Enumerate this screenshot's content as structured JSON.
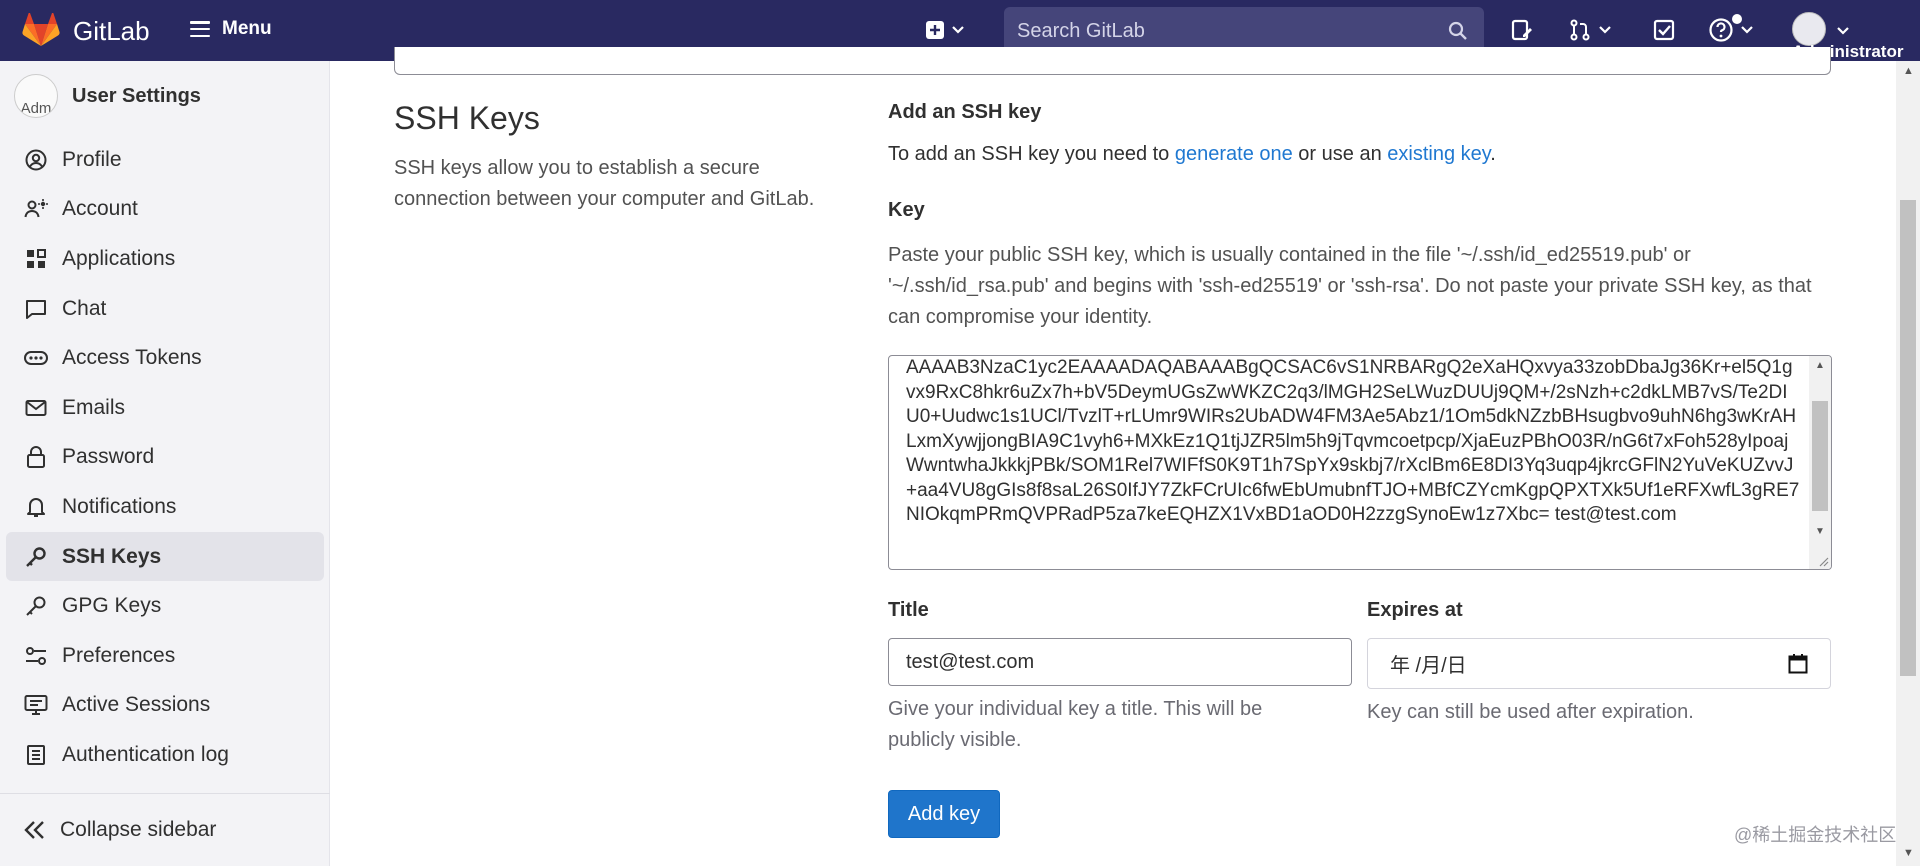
{
  "topbar": {
    "brand": "GitLab",
    "menu_label": "Menu",
    "search_placeholder": "Search GitLab",
    "user_label": "Administrator"
  },
  "sidebar": {
    "title": "User Settings",
    "avatar_alt": "Adm",
    "items": [
      {
        "label": "Profile",
        "icon": "profile-icon"
      },
      {
        "label": "Account",
        "icon": "account-icon"
      },
      {
        "label": "Applications",
        "icon": "applications-icon"
      },
      {
        "label": "Chat",
        "icon": "chat-icon"
      },
      {
        "label": "Access Tokens",
        "icon": "token-icon"
      },
      {
        "label": "Emails",
        "icon": "mail-icon"
      },
      {
        "label": "Password",
        "icon": "lock-icon"
      },
      {
        "label": "Notifications",
        "icon": "bell-icon"
      },
      {
        "label": "SSH Keys",
        "icon": "key-icon",
        "active": true
      },
      {
        "label": "GPG Keys",
        "icon": "key-icon"
      },
      {
        "label": "Preferences",
        "icon": "preferences-icon"
      },
      {
        "label": "Active Sessions",
        "icon": "monitor-icon"
      },
      {
        "label": "Authentication log",
        "icon": "log-icon"
      }
    ],
    "collapse_label": "Collapse sidebar"
  },
  "section": {
    "title": "SSH Keys",
    "description": "SSH keys allow you to establish a secure connection between your computer and GitLab."
  },
  "form": {
    "heading": "Add an SSH key",
    "intro_prefix": "To add an SSH key you need to ",
    "generate_link": "generate one",
    "intro_middle": " or use an ",
    "existing_link": "existing key",
    "intro_suffix": ".",
    "key_label": "Key",
    "key_help": "Paste your public SSH key, which is usually contained in the file '~/.ssh/id_ed25519.pub' or '~/.ssh/id_rsa.pub' and begins with 'ssh-ed25519' or 'ssh-rsa'. Do not paste your private SSH key, as that can compromise your identity.",
    "key_value": "AAAAB3NzaC1yc2EAAAADAQABAAABgQCSAC6vS1NRBARgQ2eXaHQxvya33zobDbaJg36Kr+el5Q1gvx9RxC8hkr6uZx7h+bV5DeymUGsZwWKZC2q3/lMGH2SeLWuzDUUj9QM+/2sNzh+c2dkLMB7vS/Te2DIU0+Uudwc1s1UCl/TvzlT+rLUmr9WIRs2UbADW4FM3Ae5Abz1/1Om5dkNZzbBHsugbvo9uhN6hg3wKrAHLxmXywjjongBIA9C1vyh6+MXkEz1Q1tjJZR5lm5h9jTqvmcoetpcp/XjaEuzPBhO03R/nG6t7xFoh528yIpoajWwntwhaJkkkjPBk/SOM1Rel7WIFfS0K9T1h7SpYx9skbj7/rXclBm6E8DI3Yq3uqp4jkrcGFlN2YuVeKUZvvJ+aa4VU8gGIs8f8saL26S0IfJY7ZkFCrUIc6fwEbUmubnfTJO+MBfCZYcmKgpQPXTXk5Uf1eRFXwfL3gRE7NIOkqmPRmQVPRadP5za7keEQHZX1VxBD1aOD0H2zzgSynoEw1z7Xbc= test@test.com",
    "title_label": "Title",
    "title_value": "test@test.com",
    "title_hint": "Give your individual key a title. This will be publicly visible.",
    "expires_label": "Expires at",
    "expires_value": "年 /月/日",
    "expires_hint": "Key can still be used after expiration.",
    "submit_label": "Add key"
  },
  "watermark": "@稀土掘金技术社区",
  "colors": {
    "topbar": "#292961",
    "link": "#1f78d1",
    "primary_button": "#1f75cb"
  }
}
